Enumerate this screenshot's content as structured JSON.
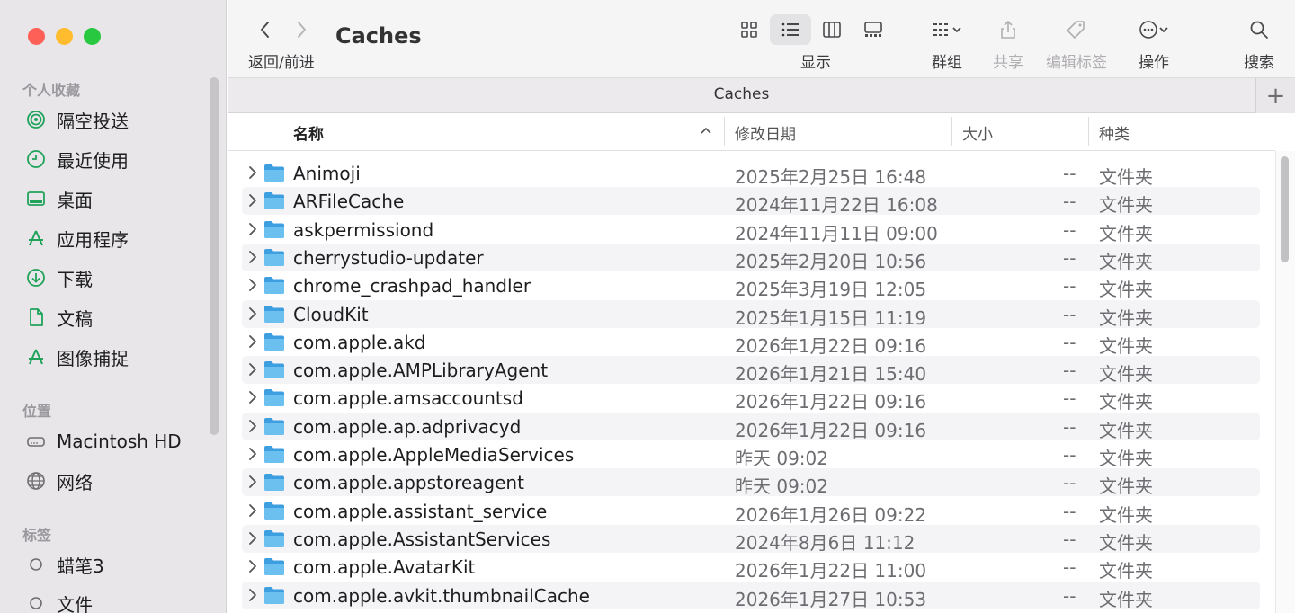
{
  "window": {
    "title": "Caches",
    "nav_label": "返回/前进",
    "path_title": "Caches",
    "add_tab": "+"
  },
  "toolbar": {
    "view_label": "显示",
    "group_label": "群组",
    "share_label": "共享",
    "tags_label": "编辑标签",
    "action_label": "操作",
    "search_label": "搜索"
  },
  "sidebar": {
    "favorites_header": "个人收藏",
    "favorites": [
      {
        "label": "隔空投送",
        "icon": "airdrop-icon"
      },
      {
        "label": "最近使用",
        "icon": "clock-icon"
      },
      {
        "label": "桌面",
        "icon": "desktop-icon"
      },
      {
        "label": "应用程序",
        "icon": "applications-icon"
      },
      {
        "label": "下载",
        "icon": "download-icon"
      },
      {
        "label": "文稿",
        "icon": "document-icon"
      },
      {
        "label": "图像捕捉",
        "icon": "image-capture-icon"
      }
    ],
    "locations_header": "位置",
    "locations": [
      {
        "label": "Macintosh HD",
        "icon": "disk-icon"
      },
      {
        "label": "网络",
        "icon": "globe-icon"
      }
    ],
    "tags_header": "标签",
    "tags": [
      {
        "label": "蜡笔3",
        "icon": "tag-circle-icon"
      },
      {
        "label": "文件",
        "icon": "tag-circle-icon"
      }
    ]
  },
  "columns": {
    "name": "名称",
    "date": "修改日期",
    "size": "大小",
    "kind": "种类"
  },
  "files": [
    {
      "name": "Animoji",
      "date": "2025年2月25日 16:48",
      "size": "--",
      "kind": "文件夹"
    },
    {
      "name": "ARFileCache",
      "date": "2024年11月22日 16:08",
      "size": "--",
      "kind": "文件夹"
    },
    {
      "name": "askpermissiond",
      "date": "2024年11月11日 09:00",
      "size": "--",
      "kind": "文件夹"
    },
    {
      "name": "cherrystudio-updater",
      "date": "2025年2月20日 10:56",
      "size": "--",
      "kind": "文件夹"
    },
    {
      "name": "chrome_crashpad_handler",
      "date": "2025年3月19日 12:05",
      "size": "--",
      "kind": "文件夹"
    },
    {
      "name": "CloudKit",
      "date": "2025年1月15日 11:19",
      "size": "--",
      "kind": "文件夹"
    },
    {
      "name": "com.apple.akd",
      "date": "2026年1月22日 09:16",
      "size": "--",
      "kind": "文件夹"
    },
    {
      "name": "com.apple.AMPLibraryAgent",
      "date": "2026年1月21日 15:40",
      "size": "--",
      "kind": "文件夹"
    },
    {
      "name": "com.apple.amsaccountsd",
      "date": "2026年1月22日 09:16",
      "size": "--",
      "kind": "文件夹"
    },
    {
      "name": "com.apple.ap.adprivacyd",
      "date": "2026年1月22日 09:16",
      "size": "--",
      "kind": "文件夹"
    },
    {
      "name": "com.apple.AppleMediaServices",
      "date": "昨天 09:02",
      "size": "--",
      "kind": "文件夹"
    },
    {
      "name": "com.apple.appstoreagent",
      "date": "昨天 09:02",
      "size": "--",
      "kind": "文件夹"
    },
    {
      "name": "com.apple.assistant_service",
      "date": "2026年1月26日 09:22",
      "size": "--",
      "kind": "文件夹"
    },
    {
      "name": "com.apple.AssistantServices",
      "date": "2024年8月6日 11:12",
      "size": "--",
      "kind": "文件夹"
    },
    {
      "name": "com.apple.AvatarKit",
      "date": "2026年1月22日 11:00",
      "size": "--",
      "kind": "文件夹"
    },
    {
      "name": "com.apple.avkit.thumbnailCache",
      "date": "2026年1月27日 10:53",
      "size": "--",
      "kind": "文件夹"
    }
  ],
  "colors": {
    "accent": "#1fa35a",
    "folder": "#5fb4ea",
    "close": "#fe5f57",
    "minimize": "#febc2e",
    "zoom": "#28c840"
  }
}
